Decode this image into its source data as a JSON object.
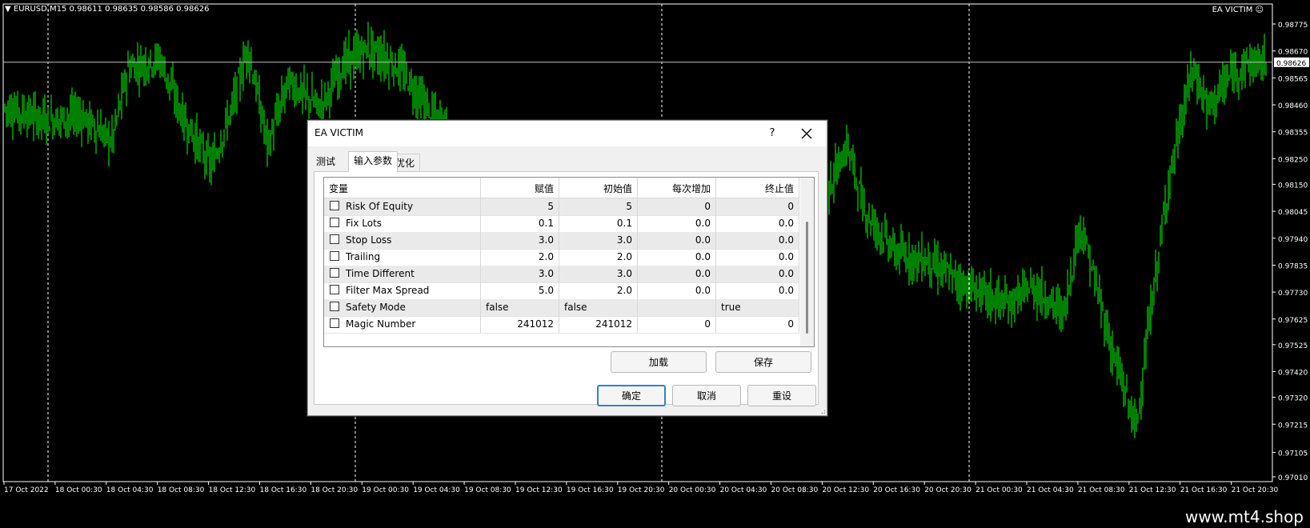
{
  "chart": {
    "header": "EURUSD,M15  0.98611 0.98635 0.98586 0.98626",
    "ea_label": "EA VICTIM",
    "current_price": "0.98626",
    "price_levels": [
      "0.98775",
      "0.98670",
      "0.98565",
      "0.98460",
      "0.98355",
      "0.98250",
      "0.98150",
      "0.98045",
      "0.97940",
      "0.97835",
      "0.97730",
      "0.97625",
      "0.97525",
      "0.97420",
      "0.97320",
      "0.97215",
      "0.97105",
      "0.97010"
    ],
    "time_labels": [
      "17 Oct 2022",
      "18 Oct 00:30",
      "18 Oct 04:30",
      "18 Oct 08:30",
      "18 Oct 12:30",
      "18 Oct 16:30",
      "18 Oct 20:30",
      "19 Oct 00:30",
      "19 Oct 04:30",
      "19 Oct 08:30",
      "19 Oct 12:30",
      "19 Oct 16:30",
      "19 Oct 20:30",
      "20 Oct 00:30",
      "20 Oct 04:30",
      "20 Oct 08:30",
      "20 Oct 12:30",
      "20 Oct 16:30",
      "20 Oct 20:30",
      "21 Oct 00:30",
      "21 Oct 04:30",
      "21 Oct 08:30",
      "21 Oct 12:30",
      "21 Oct 16:30",
      "21 Oct 20:30"
    ],
    "colors": {
      "candle": "#00ff00",
      "background": "#000000",
      "grid": "#ffffff"
    },
    "watermark": "www.mt4.shop"
  },
  "dialog": {
    "title": "EA VICTIM",
    "help_label": "?",
    "tabs": [
      {
        "label": "测试"
      },
      {
        "label": "输入参数"
      },
      {
        "label": "优化"
      }
    ],
    "grid": {
      "headers": [
        "变量",
        "赋值",
        "初始值",
        "每次增加",
        "终止值"
      ],
      "rows": [
        {
          "name": "Risk Of Equity",
          "value": "5",
          "start": "5",
          "step": "0",
          "stop": "0"
        },
        {
          "name": "Fix Lots",
          "value": "0.1",
          "start": "0.1",
          "step": "0.0",
          "stop": "0.0"
        },
        {
          "name": "Stop Loss",
          "value": "3.0",
          "start": "3.0",
          "step": "0.0",
          "stop": "0.0"
        },
        {
          "name": "Trailing",
          "value": "2.0",
          "start": "2.0",
          "step": "0.0",
          "stop": "0.0"
        },
        {
          "name": "Time Different",
          "value": "3.0",
          "start": "3.0",
          "step": "0.0",
          "stop": "0.0"
        },
        {
          "name": "Filter Max Spread",
          "value": "5.0",
          "start": "2.0",
          "step": "0.0",
          "stop": "0.0"
        },
        {
          "name": "Safety Mode",
          "value": "false",
          "start": "false",
          "step": "",
          "stop": "true"
        },
        {
          "name": "Magic Number",
          "value": "241012",
          "start": "241012",
          "step": "0",
          "stop": "0"
        }
      ]
    },
    "buttons": {
      "load": "加载",
      "save": "保存",
      "ok": "确定",
      "cancel": "取消",
      "reset": "重设"
    }
  }
}
